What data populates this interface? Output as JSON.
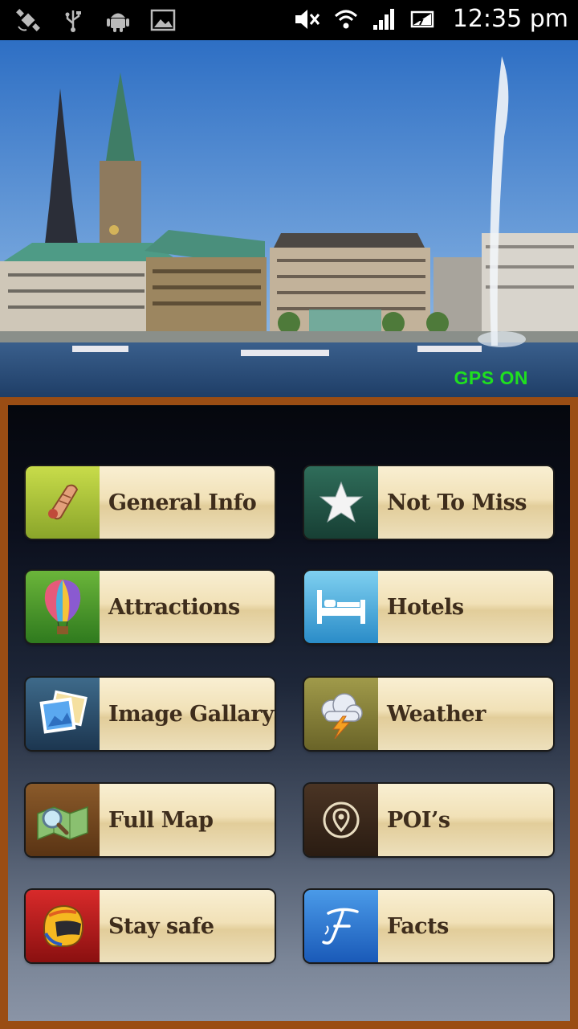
{
  "status_bar": {
    "time": "12:35 pm"
  },
  "hero": {
    "gps_status": "GPS ON"
  },
  "menu": {
    "general_info": "General Info",
    "not_to_miss": "Not To Miss",
    "attractions": "Attractions",
    "hotels": "Hotels",
    "image_gallery": "Image Gallary",
    "weather": "Weather",
    "full_map": "Full Map",
    "pois": "POI’s",
    "stay_safe": "Stay safe",
    "facts": "Facts"
  },
  "icons": {
    "general_info": "scroll-icon",
    "not_to_miss": "star-icon",
    "attractions": "hot-air-balloon-icon",
    "hotels": "bed-icon",
    "image_gallery": "photos-icon",
    "weather": "storm-cloud-icon",
    "full_map": "map-search-icon",
    "pois": "location-pin-icon",
    "stay_safe": "helmet-icon",
    "facts": "letter-f-icon"
  },
  "colors": {
    "gps": "#1fe01f",
    "panel_border": "#9a4d14",
    "label_text": "#3e2d1c"
  }
}
